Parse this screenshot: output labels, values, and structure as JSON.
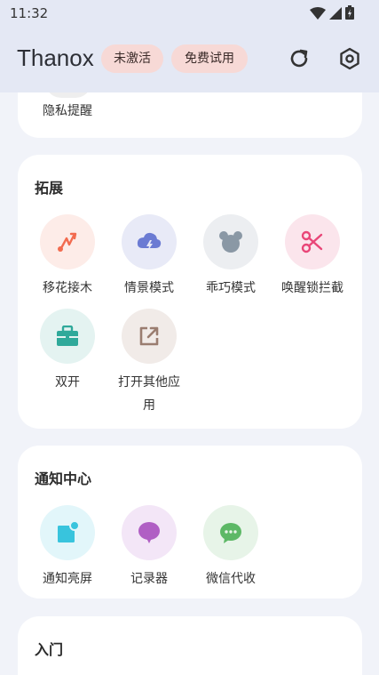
{
  "status": {
    "time": "11:32",
    "icons": [
      "wifi-icon",
      "signal-icon",
      "battery-charging-icon"
    ]
  },
  "appbar": {
    "title": "Thanox",
    "chips": [
      "未激活",
      "免费试用"
    ],
    "actions": [
      "refresh-icon",
      "settings-hexagon-icon"
    ]
  },
  "partial_card": {
    "item_label": "隐私提醒"
  },
  "extension": {
    "title": "拓展",
    "items": [
      {
        "label": "移花接木",
        "icon": "route-icon",
        "color": "#f26b4f",
        "bg": "#fdece8"
      },
      {
        "label": "情景模式",
        "icon": "cloud-lightning-icon",
        "color": "#6b7bd3",
        "bg": "#e8eaf7"
      },
      {
        "label": "乖巧模式",
        "icon": "bear-icon",
        "color": "#8a98a5",
        "bg": "#eceef1"
      },
      {
        "label": "唤醒锁拦截",
        "icon": "scissors-icon",
        "color": "#e94678",
        "bg": "#fbe5ec"
      },
      {
        "label": "双开",
        "icon": "briefcase-icon",
        "color": "#2fa99a",
        "bg": "#e4f3f1"
      },
      {
        "label": "打开其他应用",
        "icon": "open-external-icon",
        "color": "#9a7d70",
        "bg": "#f1ebe8"
      }
    ]
  },
  "notification": {
    "title": "通知中心",
    "items": [
      {
        "label": "通知亮屏",
        "icon": "notification-dot-icon",
        "color": "#38c4dd",
        "bg": "#e2f6fa"
      },
      {
        "label": "记录器",
        "icon": "chat-bubble-icon",
        "color": "#b05fc4",
        "bg": "#f3e6f7"
      },
      {
        "label": "微信代收",
        "icon": "chat-dots-icon",
        "color": "#5db866",
        "bg": "#e7f4e8"
      }
    ]
  },
  "intro": {
    "title": "入门"
  }
}
